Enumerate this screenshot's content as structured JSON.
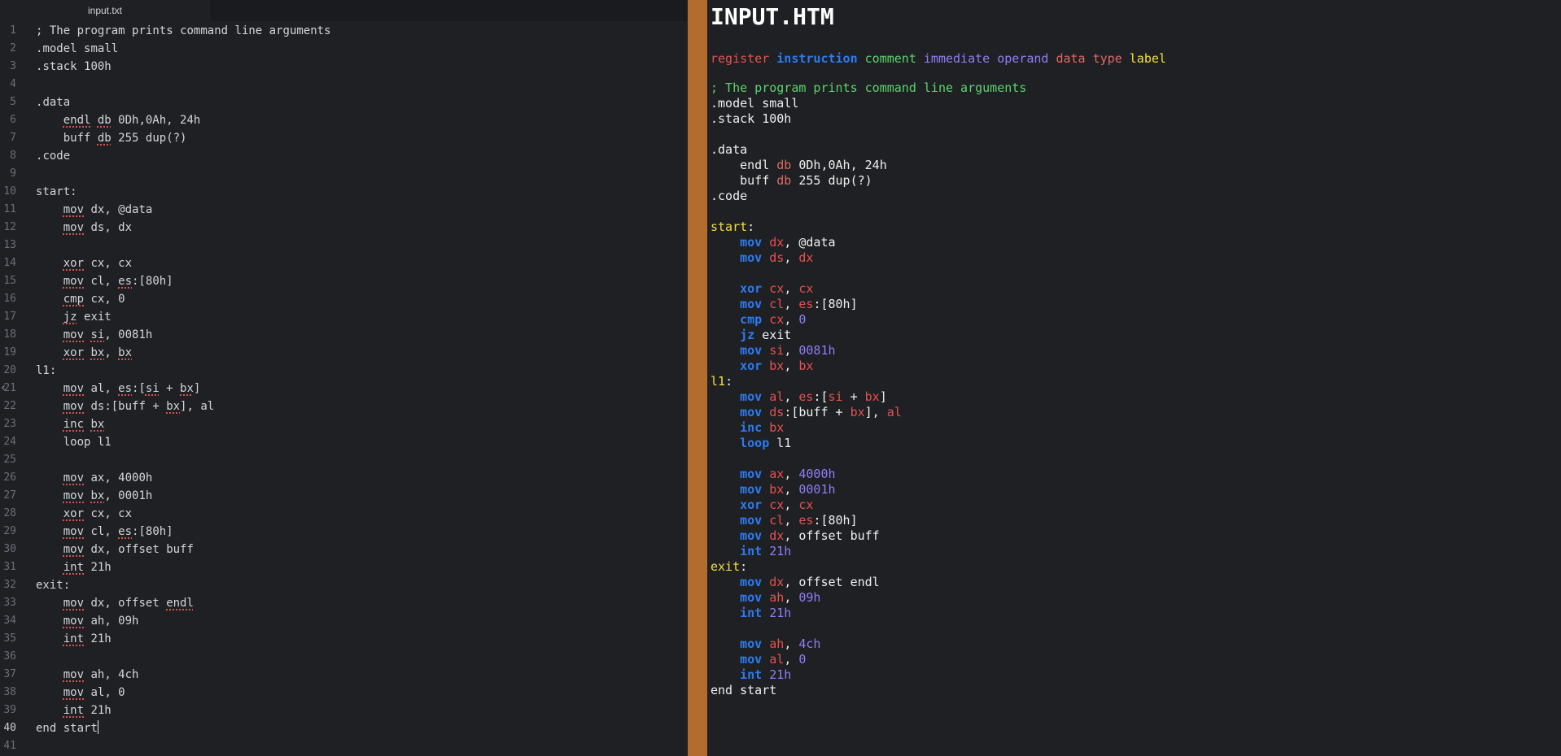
{
  "editor": {
    "tab_label": "input.txt",
    "gutter_arrow": "‹",
    "lines": [
      {
        "n": "1",
        "t": "; The program prints command line arguments"
      },
      {
        "n": "2",
        "t": ".model small"
      },
      {
        "n": "3",
        "t": ".stack 100h"
      },
      {
        "n": "4",
        "t": ""
      },
      {
        "n": "5",
        "t": ".data"
      },
      {
        "n": "6",
        "t": "    endl db 0Dh,0Ah, 24h"
      },
      {
        "n": "7",
        "t": "    buff db 255 dup(?)"
      },
      {
        "n": "8",
        "t": ".code"
      },
      {
        "n": "9",
        "t": ""
      },
      {
        "n": "10",
        "t": "start:"
      },
      {
        "n": "11",
        "t": "    mov dx, @data"
      },
      {
        "n": "12",
        "t": "    mov ds, dx"
      },
      {
        "n": "13",
        "t": ""
      },
      {
        "n": "14",
        "t": "    xor cx, cx"
      },
      {
        "n": "15",
        "t": "    mov cl, es:[80h]"
      },
      {
        "n": "16",
        "t": "    cmp cx, 0"
      },
      {
        "n": "17",
        "t": "    jz exit"
      },
      {
        "n": "18",
        "t": "    mov si, 0081h"
      },
      {
        "n": "19",
        "t": "    xor bx, bx"
      },
      {
        "n": "20",
        "t": "l1:"
      },
      {
        "n": "21",
        "t": "    mov al, es:[si + bx]"
      },
      {
        "n": "22",
        "t": "    mov ds:[buff + bx], al"
      },
      {
        "n": "23",
        "t": "    inc bx"
      },
      {
        "n": "24",
        "t": "    loop l1"
      },
      {
        "n": "25",
        "t": ""
      },
      {
        "n": "26",
        "t": "    mov ax, 4000h"
      },
      {
        "n": "27",
        "t": "    mov bx, 0001h"
      },
      {
        "n": "28",
        "t": "    xor cx, cx"
      },
      {
        "n": "29",
        "t": "    mov cl, es:[80h]"
      },
      {
        "n": "30",
        "t": "    mov dx, offset buff"
      },
      {
        "n": "31",
        "t": "    int 21h"
      },
      {
        "n": "32",
        "t": "exit:"
      },
      {
        "n": "33",
        "t": "    mov dx, offset endl"
      },
      {
        "n": "34",
        "t": "    mov ah, 09h"
      },
      {
        "n": "35",
        "t": "    int 21h"
      },
      {
        "n": "36",
        "t": ""
      },
      {
        "n": "37",
        "t": "    mov ah, 4ch"
      },
      {
        "n": "38",
        "t": "    mov al, 0"
      },
      {
        "n": "39",
        "t": "    int 21h"
      },
      {
        "n": "40",
        "t": "end start"
      },
      {
        "n": "41",
        "t": ""
      }
    ],
    "current_line": 40
  },
  "preview": {
    "title": "INPUT.HTM",
    "legend": [
      {
        "text": "register",
        "k": "reg"
      },
      {
        "text": "instruction",
        "k": "ins"
      },
      {
        "text": "comment",
        "k": "com"
      },
      {
        "text": "immediate",
        "k": "imm"
      },
      {
        "text": "operand",
        "k": "imm"
      },
      {
        "text": "data type",
        "k": "typ"
      },
      {
        "text": "label",
        "k": "lbl"
      }
    ],
    "lines": [
      [
        [
          "com",
          "; The program prints command line arguments"
        ]
      ],
      [
        [
          "plain",
          ".model small"
        ]
      ],
      [
        [
          "plain",
          ".stack 100h"
        ]
      ],
      [],
      [
        [
          "plain",
          ".data"
        ]
      ],
      [
        [
          "plain",
          "    endl "
        ],
        [
          "typ",
          "db"
        ],
        [
          "plain",
          " 0Dh,0Ah, 24h"
        ]
      ],
      [
        [
          "plain",
          "    buff "
        ],
        [
          "typ",
          "db"
        ],
        [
          "plain",
          " 255 dup(?)"
        ]
      ],
      [
        [
          "plain",
          ".code"
        ]
      ],
      [],
      [
        [
          "lbl",
          "start"
        ],
        [
          "plain",
          ":"
        ]
      ],
      [
        [
          "plain",
          "    "
        ],
        [
          "ins",
          "mov"
        ],
        [
          "plain",
          " "
        ],
        [
          "reg",
          "dx"
        ],
        [
          "plain",
          ", @data"
        ]
      ],
      [
        [
          "plain",
          "    "
        ],
        [
          "ins",
          "mov"
        ],
        [
          "plain",
          " "
        ],
        [
          "reg",
          "ds"
        ],
        [
          "plain",
          ", "
        ],
        [
          "reg",
          "dx"
        ]
      ],
      [],
      [
        [
          "plain",
          "    "
        ],
        [
          "ins",
          "xor"
        ],
        [
          "plain",
          " "
        ],
        [
          "reg",
          "cx"
        ],
        [
          "plain",
          ", "
        ],
        [
          "reg",
          "cx"
        ]
      ],
      [
        [
          "plain",
          "    "
        ],
        [
          "ins",
          "mov"
        ],
        [
          "plain",
          " "
        ],
        [
          "reg",
          "cl"
        ],
        [
          "plain",
          ", "
        ],
        [
          "reg",
          "es"
        ],
        [
          "plain",
          ":[80h]"
        ]
      ],
      [
        [
          "plain",
          "    "
        ],
        [
          "ins",
          "cmp"
        ],
        [
          "plain",
          " "
        ],
        [
          "reg",
          "cx"
        ],
        [
          "plain",
          ", "
        ],
        [
          "imm",
          "0"
        ]
      ],
      [
        [
          "plain",
          "    "
        ],
        [
          "ins",
          "jz"
        ],
        [
          "plain",
          " exit"
        ]
      ],
      [
        [
          "plain",
          "    "
        ],
        [
          "ins",
          "mov"
        ],
        [
          "plain",
          " "
        ],
        [
          "reg",
          "si"
        ],
        [
          "plain",
          ", "
        ],
        [
          "imm",
          "0081h"
        ]
      ],
      [
        [
          "plain",
          "    "
        ],
        [
          "ins",
          "xor"
        ],
        [
          "plain",
          " "
        ],
        [
          "reg",
          "bx"
        ],
        [
          "plain",
          ", "
        ],
        [
          "reg",
          "bx"
        ]
      ],
      [
        [
          "lbl",
          "l1"
        ],
        [
          "plain",
          ":"
        ]
      ],
      [
        [
          "plain",
          "    "
        ],
        [
          "ins",
          "mov"
        ],
        [
          "plain",
          " "
        ],
        [
          "reg",
          "al"
        ],
        [
          "plain",
          ", "
        ],
        [
          "reg",
          "es"
        ],
        [
          "plain",
          ":["
        ],
        [
          "reg",
          "si"
        ],
        [
          "plain",
          " + "
        ],
        [
          "reg",
          "bx"
        ],
        [
          "plain",
          "]"
        ]
      ],
      [
        [
          "plain",
          "    "
        ],
        [
          "ins",
          "mov"
        ],
        [
          "plain",
          " "
        ],
        [
          "reg",
          "ds"
        ],
        [
          "plain",
          ":[buff + "
        ],
        [
          "reg",
          "bx"
        ],
        [
          "plain",
          "], "
        ],
        [
          "reg",
          "al"
        ]
      ],
      [
        [
          "plain",
          "    "
        ],
        [
          "ins",
          "inc"
        ],
        [
          "plain",
          " "
        ],
        [
          "reg",
          "bx"
        ]
      ],
      [
        [
          "plain",
          "    "
        ],
        [
          "ins",
          "loop"
        ],
        [
          "plain",
          " l1"
        ]
      ],
      [],
      [
        [
          "plain",
          "    "
        ],
        [
          "ins",
          "mov"
        ],
        [
          "plain",
          " "
        ],
        [
          "reg",
          "ax"
        ],
        [
          "plain",
          ", "
        ],
        [
          "imm",
          "4000h"
        ]
      ],
      [
        [
          "plain",
          "    "
        ],
        [
          "ins",
          "mov"
        ],
        [
          "plain",
          " "
        ],
        [
          "reg",
          "bx"
        ],
        [
          "plain",
          ", "
        ],
        [
          "imm",
          "0001h"
        ]
      ],
      [
        [
          "plain",
          "    "
        ],
        [
          "ins",
          "xor"
        ],
        [
          "plain",
          " "
        ],
        [
          "reg",
          "cx"
        ],
        [
          "plain",
          ", "
        ],
        [
          "reg",
          "cx"
        ]
      ],
      [
        [
          "plain",
          "    "
        ],
        [
          "ins",
          "mov"
        ],
        [
          "plain",
          " "
        ],
        [
          "reg",
          "cl"
        ],
        [
          "plain",
          ", "
        ],
        [
          "reg",
          "es"
        ],
        [
          "plain",
          ":[80h]"
        ]
      ],
      [
        [
          "plain",
          "    "
        ],
        [
          "ins",
          "mov"
        ],
        [
          "plain",
          " "
        ],
        [
          "reg",
          "dx"
        ],
        [
          "plain",
          ", offset buff"
        ]
      ],
      [
        [
          "plain",
          "    "
        ],
        [
          "ins",
          "int"
        ],
        [
          "plain",
          " "
        ],
        [
          "imm",
          "21h"
        ]
      ],
      [
        [
          "lbl",
          "exit"
        ],
        [
          "plain",
          ":"
        ]
      ],
      [
        [
          "plain",
          "    "
        ],
        [
          "ins",
          "mov"
        ],
        [
          "plain",
          " "
        ],
        [
          "reg",
          "dx"
        ],
        [
          "plain",
          ", offset endl"
        ]
      ],
      [
        [
          "plain",
          "    "
        ],
        [
          "ins",
          "mov"
        ],
        [
          "plain",
          " "
        ],
        [
          "reg",
          "ah"
        ],
        [
          "plain",
          ", "
        ],
        [
          "imm",
          "09h"
        ]
      ],
      [
        [
          "plain",
          "    "
        ],
        [
          "ins",
          "int"
        ],
        [
          "plain",
          " "
        ],
        [
          "imm",
          "21h"
        ]
      ],
      [],
      [
        [
          "plain",
          "    "
        ],
        [
          "ins",
          "mov"
        ],
        [
          "plain",
          " "
        ],
        [
          "reg",
          "ah"
        ],
        [
          "plain",
          ", "
        ],
        [
          "imm",
          "4ch"
        ]
      ],
      [
        [
          "plain",
          "    "
        ],
        [
          "ins",
          "mov"
        ],
        [
          "plain",
          " "
        ],
        [
          "reg",
          "al"
        ],
        [
          "plain",
          ", "
        ],
        [
          "imm",
          "0"
        ]
      ],
      [
        [
          "plain",
          "    "
        ],
        [
          "ins",
          "int"
        ],
        [
          "plain",
          " "
        ],
        [
          "imm",
          "21h"
        ]
      ],
      [
        [
          "plain",
          "end start"
        ]
      ]
    ]
  },
  "colors": {
    "background": "#1e2024",
    "divider": "#b36b2e",
    "register": "#e8514e",
    "instruction": "#2d7bf0",
    "comment": "#5dd36b",
    "immediate": "#8f7ff5",
    "data_type": "#e06a62",
    "label": "#f2e03c"
  }
}
